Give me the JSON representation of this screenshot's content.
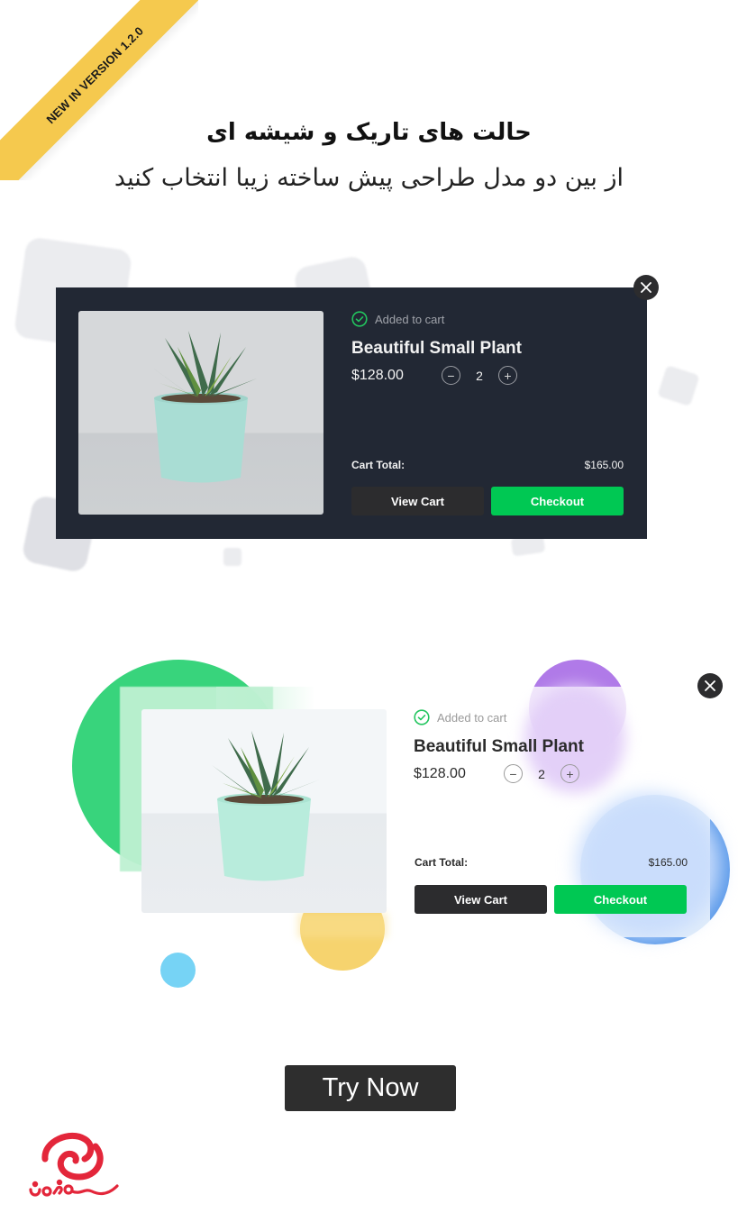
{
  "ribbon": {
    "text": "NEW IN VERSION 1.2.0",
    "color": "#f5c94e"
  },
  "header": {
    "title": "حالت های تاریک و شیشه ای",
    "subtitle": "از بین دو مدل طراحی پیش ساخته زیبا انتخاب کنید"
  },
  "dark_card": {
    "theme": "dark",
    "background": "#222834",
    "status": "Added to cart",
    "product_name": "Beautiful Small Plant",
    "price": "$128.00",
    "quantity": "2",
    "minus_symbol": "−",
    "plus_symbol": "+",
    "total_label": "Cart Total:",
    "total_value": "$165.00",
    "view_cart_label": "View Cart",
    "checkout_label": "Checkout"
  },
  "glass_card": {
    "theme": "glass",
    "status": "Added to cart",
    "product_name": "Beautiful Small Plant",
    "price": "$128.00",
    "quantity": "2",
    "minus_symbol": "−",
    "plus_symbol": "+",
    "total_label": "Cart Total:",
    "total_value": "$165.00",
    "view_cart_label": "View Cart",
    "checkout_label": "Checkout"
  },
  "colors": {
    "accent_green": "#00c853",
    "check_green": "#22c55e",
    "dark_button": "#2c2c2e",
    "circle_green": "#38d47c",
    "circle_purple": "#b07ae8",
    "circle_blue": "#5b9aea",
    "circle_yellow": "#f6d36e",
    "circle_lightblue": "#76d3f5",
    "logo_red": "#e3263a"
  },
  "cta": {
    "label": "Try Now"
  },
  "logo": {
    "name": "logo-mark"
  }
}
